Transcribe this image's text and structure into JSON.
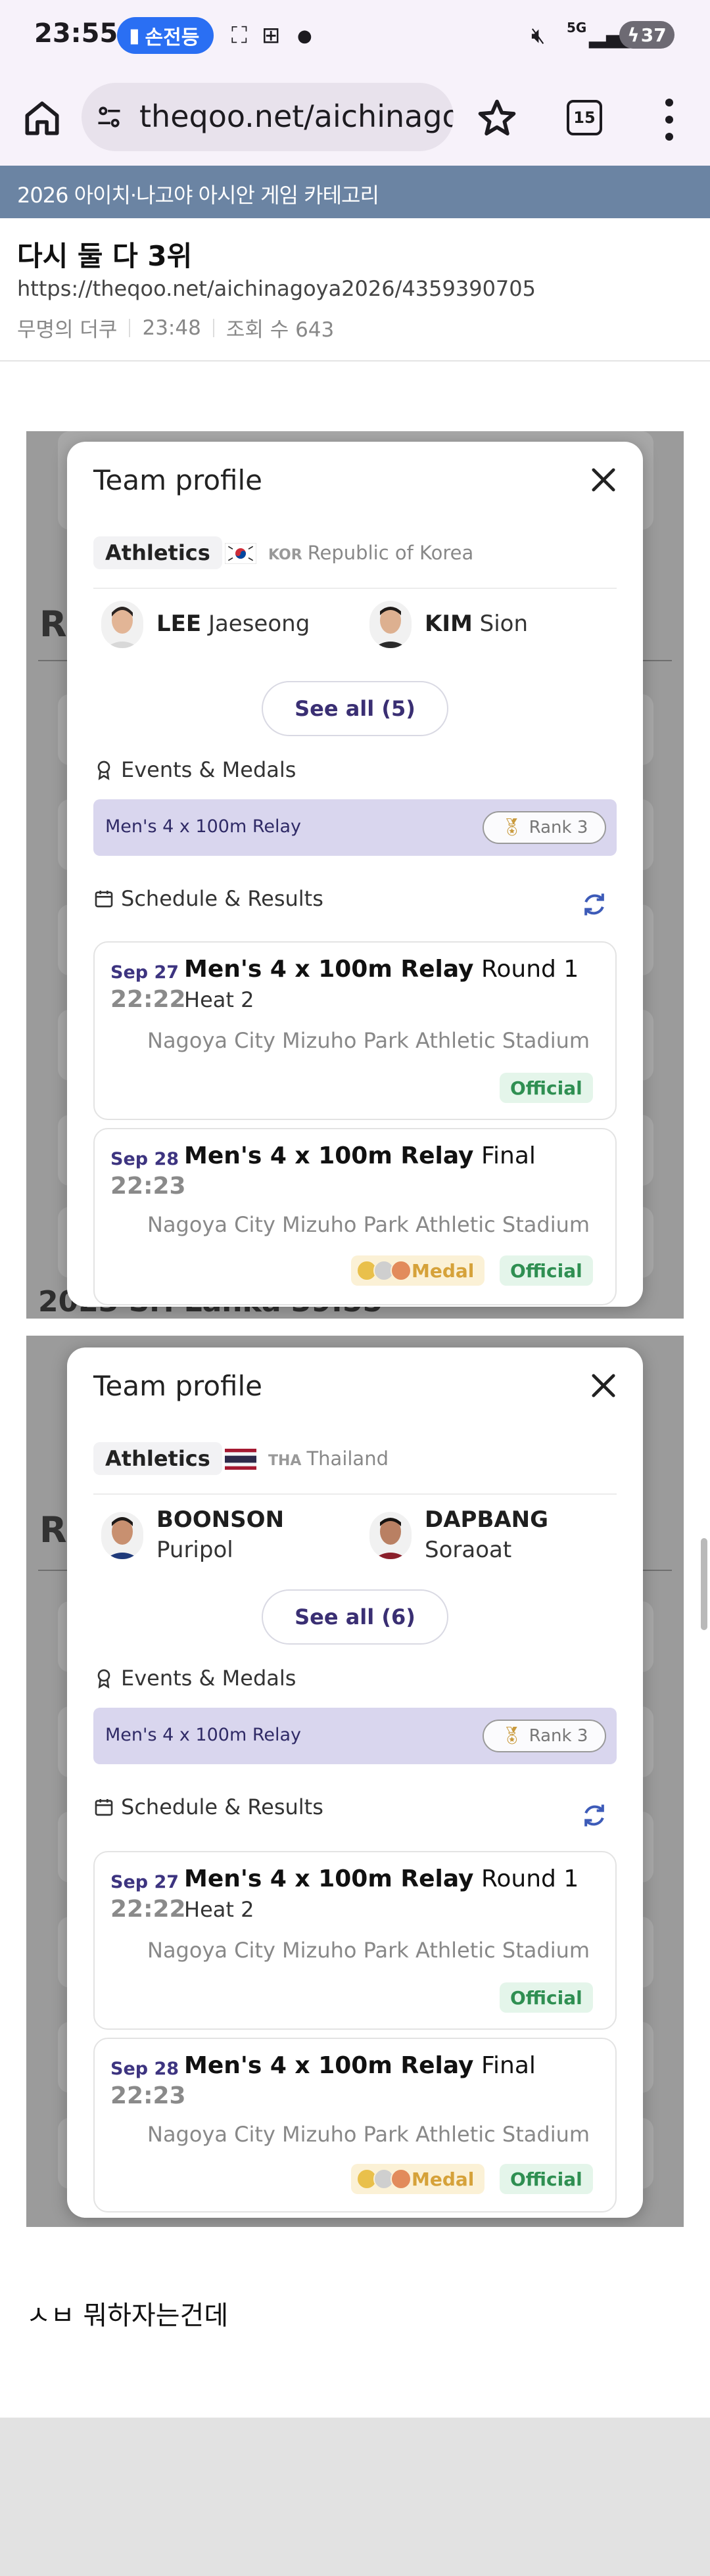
{
  "status_bar": {
    "time": "23:55",
    "pill_label": "손전등",
    "battery": "37",
    "network": "5G"
  },
  "browser": {
    "url": "theqoo.net/aichinago",
    "tab_count": "15"
  },
  "post": {
    "category": "2026 아이치·나고야 아시안 게임 카테고리",
    "title": "다시 둘 다 3위",
    "url": "https://theqoo.net/aichinagoya2026/4359390705",
    "author": "무명의 더쿠",
    "time": "23:48",
    "views": "조회 수 643",
    "comment": "ㅅㅂ 뭐하자는건데"
  },
  "profiles": [
    {
      "title": "Team profile",
      "sport": "Athletics",
      "country_code": "KOR",
      "country_name": "Republic of Korea",
      "athletes": [
        {
          "last": "LEE",
          "first": "Jaeseong"
        },
        {
          "last": "KIM",
          "first": "Sion"
        }
      ],
      "see_all": "See all (5)",
      "events_header": "Events & Medals",
      "medal_event": "Men's 4 x 100m Relay",
      "rank": "Rank 3",
      "schedule_header": "Schedule & Results",
      "results": [
        {
          "date": "Sep 27",
          "time": "22:22",
          "event": "Men's 4 x 100m Relay",
          "round": "Round 1",
          "heat": "Heat 2",
          "venue": "Nagoya City Mizuho Park Athletic Stadium",
          "status": "Official"
        },
        {
          "date": "Sep 28",
          "time": "22:23",
          "event": "Men's 4 x 100m Relay",
          "round": "Final",
          "heat": "",
          "venue": "Nagoya City Mizuho Park Athletic Stadium",
          "medal": "Medal",
          "status": "Official"
        }
      ],
      "bg_bottom": "2023  Sri Lanka  39.55"
    },
    {
      "title": "Team profile",
      "sport": "Athletics",
      "country_code": "THA",
      "country_name": "Thailand",
      "athletes": [
        {
          "last": "BOONSON",
          "first": "Puripol"
        },
        {
          "last": "DAPBANG",
          "first": "Soraoat"
        }
      ],
      "see_all": "See all (6)",
      "events_header": "Events & Medals",
      "medal_event": "Men's 4 x 100m Relay",
      "rank": "Rank 3",
      "schedule_header": "Schedule & Results",
      "results": [
        {
          "date": "Sep 27",
          "time": "22:22",
          "event": "Men's 4 x 100m Relay",
          "round": "Round 1",
          "heat": "Heat 2",
          "venue": "Nagoya City Mizuho Park Athletic Stadium",
          "status": "Official"
        },
        {
          "date": "Sep 28",
          "time": "22:23",
          "event": "Men's 4 x 100m Relay",
          "round": "Final",
          "heat": "",
          "venue": "Nagoya City Mizuho Park Athletic Stadium",
          "medal": "Medal",
          "status": "Official"
        }
      ]
    }
  ],
  "colors": {
    "accent": "#3d3480",
    "official_green": "#2f8f52",
    "medal_gold": "#d6a23a",
    "category_bar": "#6b84a3"
  }
}
